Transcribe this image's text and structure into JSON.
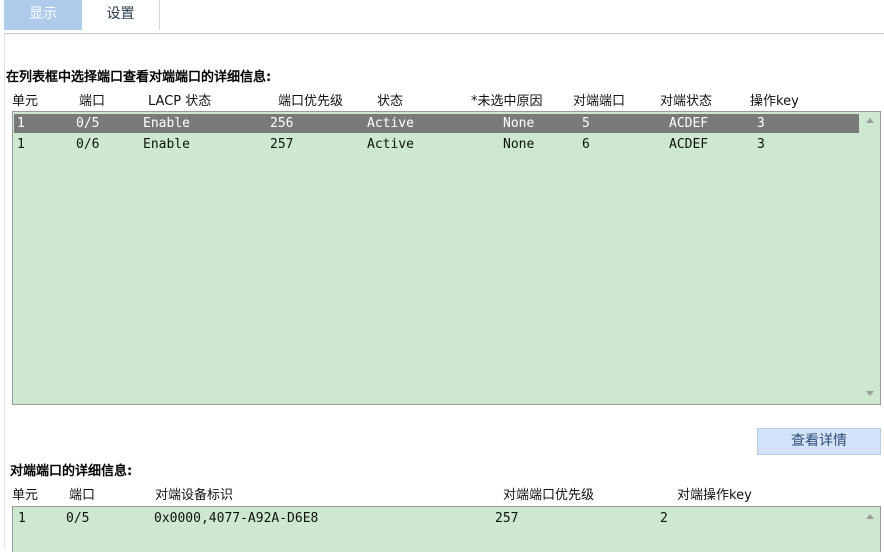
{
  "tabs": [
    {
      "label": "显示",
      "active": true
    },
    {
      "label": "设置",
      "active": false
    }
  ],
  "ports_section": {
    "title": "在列表框中选择端口查看对端端口的详细信息:",
    "columns": [
      "单元",
      "端口",
      "LACP 状态",
      "端口优先级",
      "状态",
      "*未选中原因",
      "对端端口",
      "对端状态",
      "操作key"
    ],
    "rows": [
      {
        "selected": true,
        "cells": [
          "1",
          "0/5",
          "Enable",
          "256",
          "Active",
          "None",
          "5",
          "ACDEF",
          "3"
        ]
      },
      {
        "selected": false,
        "cells": [
          "1",
          "0/6",
          "Enable",
          "257",
          "Active",
          "None",
          "6",
          "ACDEF",
          "3"
        ]
      }
    ]
  },
  "detail_button": {
    "label": "查看详情"
  },
  "peer_section": {
    "title": "对端端口的详细信息:",
    "columns": [
      "单元",
      "端口",
      "对端设备标识",
      "对端端口优先级",
      "对端操作key"
    ],
    "rows": [
      {
        "cells": [
          "1",
          "0/5",
          "0x0000,4077-A92A-D6E8",
          "257",
          "2"
        ]
      }
    ]
  },
  "colors": {
    "list_bg": "#cde8cf",
    "selected_row_bg": "#7a7a7a",
    "active_tab_bg": "#aecbeb",
    "button_bg": "#d4e3f7"
  }
}
